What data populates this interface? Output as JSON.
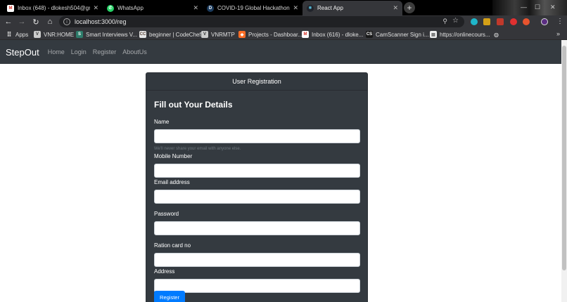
{
  "browser": {
    "tabs": [
      {
        "title": "Inbox (648) - dlokesh504@gmai",
        "icon": "gmail-icon",
        "active": false
      },
      {
        "title": "WhatsApp",
        "icon": "whatsapp-icon",
        "active": false
      },
      {
        "title": "COVID-19 Global Hackathon 1.0",
        "icon": "devpost-icon",
        "active": false
      },
      {
        "title": "React App",
        "icon": "react-icon",
        "active": true
      }
    ],
    "url": "localhost:3000/reg",
    "bookmarks": [
      {
        "label": "Apps",
        "icon": "apps-grid-icon"
      },
      {
        "label": "VNR:HOME",
        "icon": "vnr-icon"
      },
      {
        "label": "Smart Interviews V...",
        "icon": "smart-interviews-icon"
      },
      {
        "label": "beginner | CodeChef",
        "icon": "codechef-icon"
      },
      {
        "label": "VNRMTP",
        "icon": "vnrmtp-icon"
      },
      {
        "label": "Projects - Dashboar...",
        "icon": "gitlab-icon"
      },
      {
        "label": "Inbox (616) - dloke...",
        "icon": "gmail-icon"
      },
      {
        "label": "CamScanner Sign i...",
        "icon": "camscanner-icon"
      },
      {
        "label": "https://onlinecours...",
        "icon": "page-icon"
      }
    ]
  },
  "navbar": {
    "brand": "StepOut",
    "links": [
      "Home",
      "Login",
      "Register",
      "AboutUs"
    ]
  },
  "form": {
    "header": "User Registration",
    "title": "Fill out Your Details",
    "fields": {
      "name_label": "Name",
      "name_help": "We'll never share your email with anyone else.",
      "mobile_label": "Mobile Number",
      "email_label": "Email address",
      "password_label": "Password",
      "ration_label": "Ration card no",
      "address_label": "Address"
    },
    "submit_label": "Register"
  },
  "colors": {
    "navbar_bg": "#343a40",
    "card_bg": "#343a40",
    "primary": "#007bff"
  }
}
